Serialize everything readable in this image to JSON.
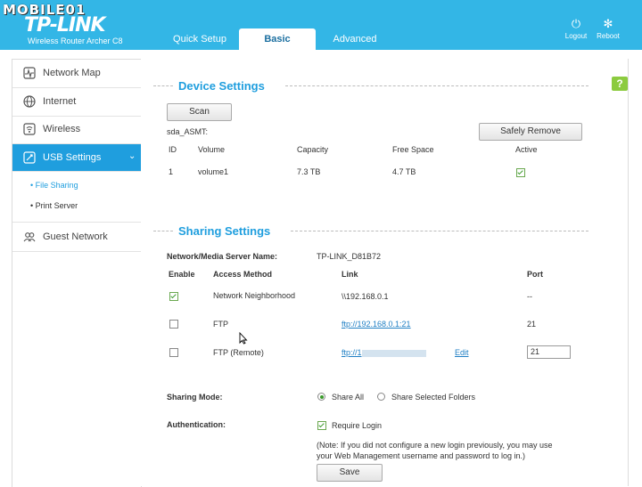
{
  "watermark": "MOBILE01",
  "brand": {
    "name": "TP-LINK",
    "model": "Wireless Router Archer C8"
  },
  "tabs": [
    {
      "label": "Quick Setup"
    },
    {
      "label": "Basic"
    },
    {
      "label": "Advanced"
    }
  ],
  "header_buttons": {
    "logout": "Logout",
    "reboot": "Reboot"
  },
  "sidebar": {
    "items": [
      {
        "label": "Network Map",
        "icon": "pulse-icon"
      },
      {
        "label": "Internet",
        "icon": "globe-icon"
      },
      {
        "label": "Wireless",
        "icon": "wifi-icon"
      },
      {
        "label": "USB Settings",
        "icon": "usb-icon"
      },
      {
        "label": "Guest Network",
        "icon": "users-icon"
      }
    ],
    "subitems": [
      {
        "label": "File Sharing"
      },
      {
        "label": "Print Server"
      }
    ]
  },
  "help_label": "?",
  "device": {
    "title": "Device Settings",
    "scan_label": "Scan",
    "disk_name": "sda_ASMT:",
    "safely_remove_label": "Safely Remove",
    "columns": [
      "ID",
      "Volume",
      "Capacity",
      "Free Space",
      "Active"
    ],
    "rows": [
      {
        "id": "1",
        "volume": "volume1",
        "capacity": "7.3 TB",
        "free": "4.7 TB",
        "active": true
      }
    ]
  },
  "sharing": {
    "title": "Sharing Settings",
    "server_name_label": "Network/Media Server Name:",
    "server_name_value": "TP-LINK_D81B72",
    "columns": [
      "Enable",
      "Access Method",
      "Link",
      "Port"
    ],
    "rows": [
      {
        "enabled": true,
        "method": "Network Neighborhood",
        "link": "\\\\192.168.0.1",
        "port": "--"
      },
      {
        "enabled": false,
        "method": "FTP",
        "link": "ftp://192.168.0.1:21",
        "port": "21"
      },
      {
        "enabled": false,
        "method": "FTP (Remote)",
        "link": "ftp://1",
        "edit": "Edit",
        "port": "21"
      }
    ],
    "mode_label": "Sharing Mode:",
    "mode_options": [
      "Share All",
      "Share Selected Folders"
    ],
    "mode_selected": "Share All",
    "auth_label": "Authentication:",
    "require_login_label": "Require Login",
    "require_login": true,
    "note_line1": "(Note: If you did not configure a new login previously, you may use",
    "note_line2": "your Web Management username and password to log in.)",
    "save_label": "Save"
  },
  "colors": {
    "header": "#33b6e6",
    "accent": "#1f9ede",
    "help": "#8ccb3f"
  }
}
